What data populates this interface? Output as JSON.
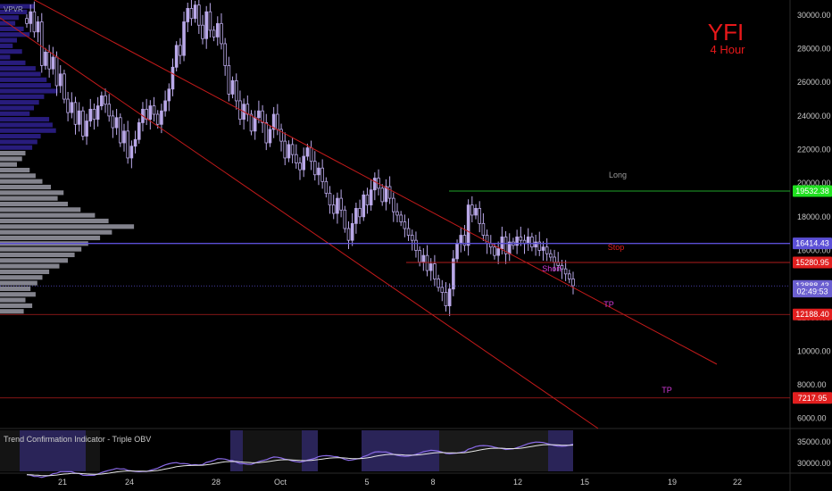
{
  "header": {
    "vpvr_label": "VPVR"
  },
  "title": {
    "symbol": "YFI",
    "timeframe": "4 Hour"
  },
  "indicator": {
    "title": "Trend Confirmation Indicator - Triple OBV"
  },
  "colors": {
    "background": "#000000",
    "candle": "#b9a8e8",
    "channel": "#c21a1a",
    "level_blue": "#5b4fd6",
    "level_green": "#1fa52a",
    "level_red": "#b01c1c",
    "annotation": "#c21ec8"
  },
  "annotations": [
    {
      "text": "Long",
      "color": "#9a9a9a"
    },
    {
      "text": "Stop",
      "color": "#e11f1f"
    },
    {
      "text": "Short",
      "color": "#d23ad8"
    },
    {
      "text": "TP",
      "color": "#d23ad8"
    },
    {
      "text": "TP",
      "color": "#d23ad8"
    }
  ],
  "chart_data": [
    {
      "type": "line",
      "subtype": "candlestick",
      "y_axis": {
        "range": [
          5400,
          30900
        ],
        "ticks": [
          "30000.00",
          "28000.00",
          "26000.00",
          "24000.00",
          "22000.00",
          "20000.00",
          "18000.00",
          "16000.00",
          "14000.00",
          "12000.00",
          "10000.00",
          "8000.00",
          "6000.00"
        ],
        "position": "right"
      },
      "x_axis": {
        "ticks": [
          "21",
          "24",
          "28",
          "Oct",
          "5",
          "8",
          "12",
          "15",
          "19",
          "22"
        ]
      },
      "price_labels": [
        {
          "text": "19532.38",
          "color": "#1fe01f",
          "value": 19532.38
        },
        {
          "text": "16414.43",
          "color": "#5b4fd6",
          "value": 16414.43
        },
        {
          "text": "15280.95",
          "color": "#e11f1f",
          "value": 15280.95
        },
        {
          "text": "13888.43",
          "color": "#6b5fd0",
          "value": 13888.43
        },
        {
          "text": "02:49:53",
          "color": "#6b5fd0",
          "value": 13550
        },
        {
          "text": "12188.40",
          "color": "#e11f1f",
          "value": 12188.4
        },
        {
          "text": "7217.95",
          "color": "#e11f1f",
          "value": 7217.95
        }
      ],
      "closes": [
        29500,
        30200,
        29000,
        29600,
        27000,
        27800,
        26800,
        27500,
        25800,
        26500,
        25000,
        24200,
        24800,
        23500,
        24300,
        22800,
        23700,
        24400,
        23800,
        24600,
        25200,
        24700,
        24000,
        23300,
        23900,
        22400,
        23100,
        21500,
        22200,
        22600,
        23600,
        24400,
        23800,
        24600,
        24100,
        23500,
        24300,
        24900,
        25600,
        26900,
        28200,
        27600,
        29600,
        30400,
        29800,
        30600,
        29400,
        28600,
        30200,
        29100,
        28700,
        29500,
        28300,
        27000,
        25300,
        26100,
        24900,
        23800,
        24700,
        24100,
        23100,
        23900,
        24300,
        23600,
        22400,
        23200,
        24100,
        23200,
        22500,
        21500,
        22300,
        21700,
        21200,
        20800,
        21600,
        22100,
        21300,
        20500,
        20900,
        20100,
        19400,
        18700,
        18200,
        19100,
        18400,
        17300,
        16600,
        17600,
        18500,
        18000,
        19300,
        18700,
        19600,
        20300,
        19700,
        18900,
        19800,
        19100,
        18300,
        18100,
        17700,
        17300,
        16900,
        16600,
        16000,
        15300,
        15700,
        14800,
        15200,
        14300,
        13800,
        13500,
        12700,
        13700,
        15500,
        16400,
        16900,
        16300,
        18700,
        18100,
        18500,
        17600,
        16900,
        16400,
        16200,
        15700,
        16100,
        16800,
        15800,
        16500,
        16300,
        16800,
        16600,
        16400,
        16800,
        16200,
        16500,
        16000,
        16200,
        15800,
        15600,
        15300,
        15100,
        14900,
        14600,
        14300,
        13900
      ],
      "volume_profile": {
        "max_width": 158,
        "bars": [
          40,
          32,
          22,
          18,
          28,
          35,
          20,
          15,
          26,
          12,
          30,
          42,
          48,
          55,
          60,
          68,
          52,
          46,
          40,
          35,
          58,
          62,
          66,
          48,
          44,
          38,
          30,
          26,
          20,
          35,
          42,
          50,
          60,
          75,
          68,
          80,
          95,
          112,
          128,
          158,
          132,
          118,
          104,
          96,
          88,
          80,
          70,
          58,
          50,
          44,
          36,
          42,
          30,
          38,
          28
        ]
      },
      "level_values": {
        "long": 19532.38,
        "blue": 16414.43,
        "stop": 15280.95,
        "current": 13888.43,
        "tp1": 12188.4,
        "tp2": 7217.95
      }
    },
    {
      "type": "line",
      "title": "Trend Confirmation Indicator - Triple OBV",
      "y_axis": {
        "ticks": [
          "35000.00",
          "30000.00"
        ]
      },
      "series": [
        {
          "color": "#8a6ae8"
        },
        {
          "color": "#e6e6e6"
        }
      ]
    }
  ]
}
